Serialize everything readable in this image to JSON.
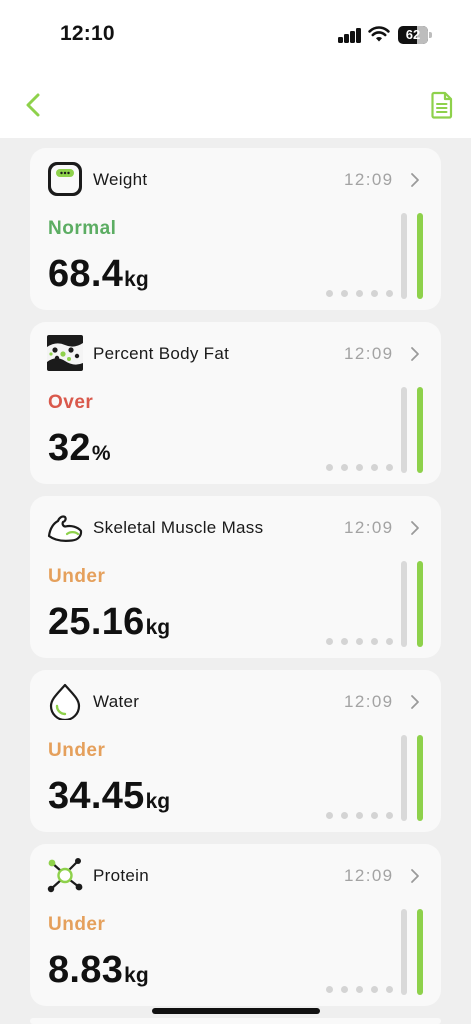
{
  "status_bar": {
    "time": "12:10",
    "battery_level": "62"
  },
  "colors": {
    "accent": "#8ed14b",
    "normal": "#5cad63",
    "over": "#d9594c",
    "under": "#e5a05c",
    "time_gray": "#a3a3a3",
    "track_gray": "#d9d9d9"
  },
  "nav": {
    "back_icon": "chevron-left-icon",
    "report_icon": "document-icon"
  },
  "metrics": [
    {
      "icon": "scale-icon",
      "title": "Weight",
      "time": "12:09",
      "status": "Normal",
      "status_color": "#5cad63",
      "value": "68.4",
      "unit": "kg"
    },
    {
      "icon": "body-fat-icon",
      "title": "Percent Body Fat",
      "time": "12:09",
      "status": "Over",
      "status_color": "#d9594c",
      "value": "32",
      "unit": "%"
    },
    {
      "icon": "muscle-icon",
      "title": "Skeletal Muscle Mass",
      "time": "12:09",
      "status": "Under",
      "status_color": "#e5a05c",
      "value": "25.16",
      "unit": "kg"
    },
    {
      "icon": "water-drop-icon",
      "title": "Water",
      "time": "12:09",
      "status": "Under",
      "status_color": "#e5a05c",
      "value": "34.45",
      "unit": "kg"
    },
    {
      "icon": "protein-molecule-icon",
      "title": "Protein",
      "time": "12:09",
      "status": "Under",
      "status_color": "#e5a05c",
      "value": "8.83",
      "unit": "kg"
    }
  ]
}
